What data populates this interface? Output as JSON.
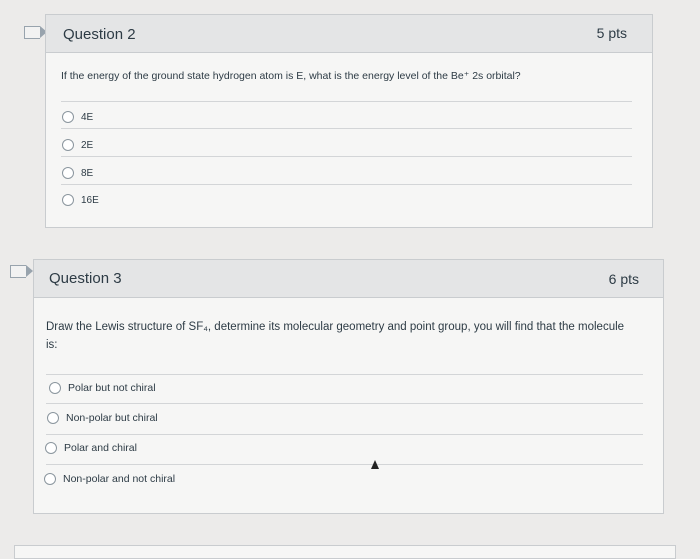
{
  "question2": {
    "title": "Question 2",
    "points": "5 pts",
    "prompt": "If the energy of the ground state hydrogen atom is E, what is the energy level of the Be⁺ 2s orbital?",
    "options": [
      "4E",
      "2E",
      "8E",
      "16E"
    ]
  },
  "question3": {
    "title": "Question 3",
    "points": "6 pts",
    "prompt": "Draw the Lewis structure of SF₄, determine its molecular geometry and point group, you will find that the molecule is:",
    "options": [
      "Polar but not chiral",
      "Non-polar but chiral",
      "Polar and chiral",
      "Non-polar and not chiral"
    ]
  },
  "icons": {
    "flag": "bookmark-flag-icon",
    "pointer": "mouse-pointer-icon"
  }
}
